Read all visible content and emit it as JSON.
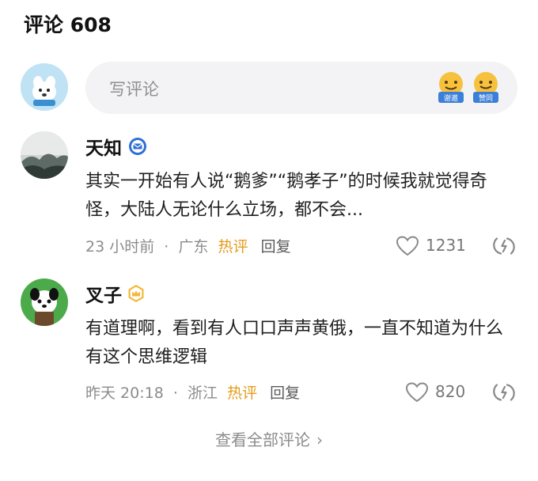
{
  "header": {
    "title": "评论 608"
  },
  "composer": {
    "placeholder": "写评论",
    "emoji_1_label": "谢邀",
    "emoji_2_label": "赞同"
  },
  "comments": [
    {
      "username": "天知",
      "text": "其实一开始有人说“鹅爹”“鹅孝子”的时候我就觉得奇怪，大陆人无论什么立场，都不会...",
      "time": "23 小时前",
      "location": "广东",
      "hot_label": "热评",
      "reply_label": "回复",
      "likes": "1231"
    },
    {
      "username": "叉子",
      "text": "有道理啊，看到有人口口声声黄俄，一直不知道为什么有这个思维逻辑",
      "time": "昨天 20:18",
      "location": "浙江",
      "hot_label": "热评",
      "reply_label": "回复",
      "likes": "820"
    }
  ],
  "footer": {
    "view_all": "查看全部评论",
    "chevron": "›"
  },
  "icons": {
    "badge_1": "verified-blue-icon",
    "badge_2": "crown-badge-icon",
    "like": "heart-outline-icon",
    "share": "share-icon"
  },
  "colors": {
    "accent": "#e59b1c",
    "muted": "#8c8c8c",
    "input_bg": "#f3f3f5"
  }
}
